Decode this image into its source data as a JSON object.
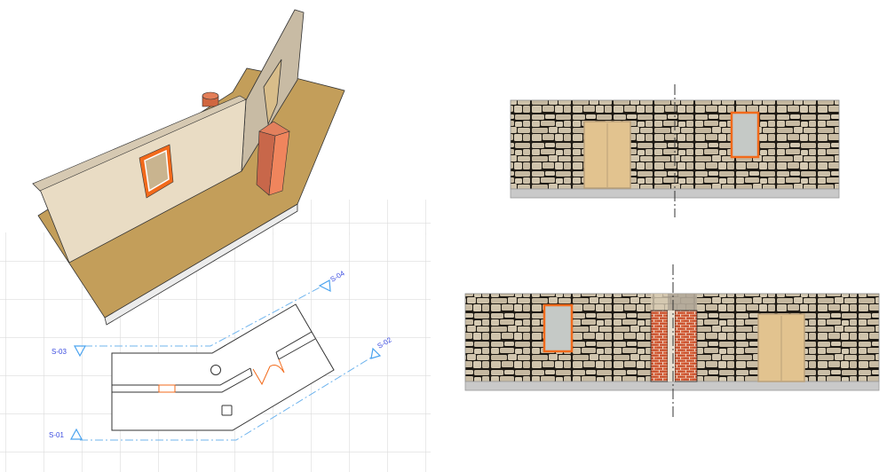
{
  "plan": {
    "section_markers": [
      {
        "label": "S-01"
      },
      {
        "label": "S-02"
      },
      {
        "label": "S-03"
      },
      {
        "label": "S-04"
      }
    ]
  },
  "colors": {
    "section_line": "#6fb4ee",
    "marker_text": "#3a4be0",
    "opening": "#f26a1b",
    "floor": "#c39e5a",
    "wall_face": "#e9dcc4",
    "stone": "#cbbfa8",
    "brick": "#d0522c",
    "door": "#e2c38f",
    "glass": "#c5c9c6"
  }
}
